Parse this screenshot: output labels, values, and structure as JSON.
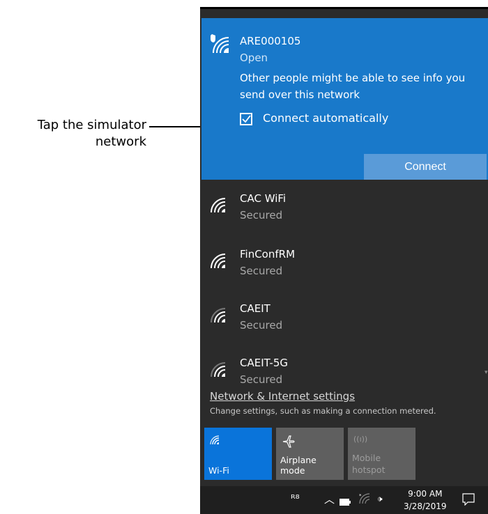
{
  "callout": {
    "line1": "Tap the simulator",
    "line2": "network"
  },
  "selected_network": {
    "name": "ARE000105",
    "status": "Open",
    "warning": "Other people might be able to see info you send over this network",
    "auto_connect_label": "Connect automatically",
    "auto_connect_checked": true,
    "connect_label": "Connect"
  },
  "networks": [
    {
      "name": "CAC WiFi",
      "status": "Secured"
    },
    {
      "name": "FinConfRM",
      "status": "Secured"
    },
    {
      "name": "CAEIT",
      "status": "Secured"
    },
    {
      "name": "CAEIT-5G",
      "status": "Secured"
    }
  ],
  "settings": {
    "link": "Network & Internet settings",
    "subtext": "Change settings, such as making a connection metered."
  },
  "quick_actions": {
    "wifi": "Wi-Fi",
    "airplane": "Airplane mode",
    "hotspot_line1": "Mobile",
    "hotspot_line2": "hotspot"
  },
  "taskbar": {
    "time": "9:00 AM",
    "date": "3/28/2019"
  },
  "colors": {
    "accent": "#1979ca",
    "panel_bg": "#2b2b2b",
    "wifi_tile": "#0a74da"
  }
}
